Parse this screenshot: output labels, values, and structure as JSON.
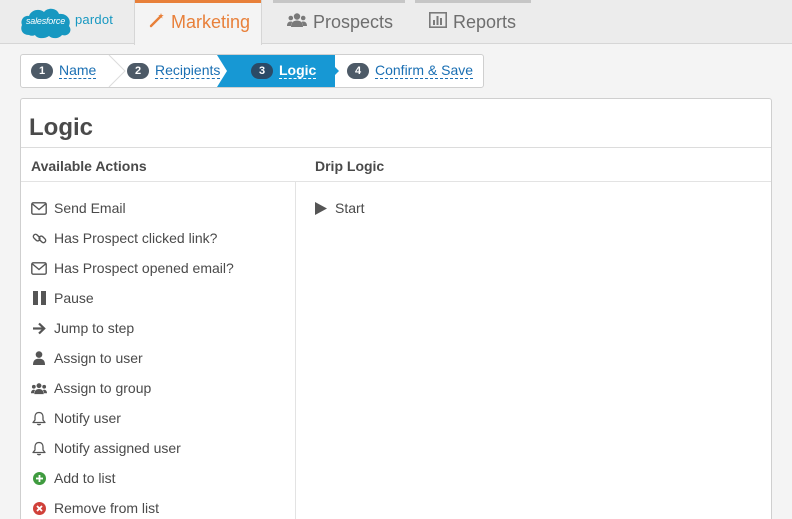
{
  "brand": {
    "cloud_text": "salesforce",
    "product_text": "pardot"
  },
  "nav": {
    "tabs": [
      {
        "label": "Marketing",
        "icon": "magic-wand-icon",
        "active": true
      },
      {
        "label": "Prospects",
        "icon": "users-icon",
        "active": false
      },
      {
        "label": "Reports",
        "icon": "bar-chart-icon",
        "active": false
      }
    ]
  },
  "wizard": {
    "steps": [
      {
        "num": "1",
        "label": "Name"
      },
      {
        "num": "2",
        "label": "Recipients"
      },
      {
        "num": "3",
        "label": "Logic",
        "current": true
      },
      {
        "num": "4",
        "label": "Confirm & Save"
      }
    ]
  },
  "panel": {
    "title": "Logic",
    "actions_header": "Available Actions",
    "drip_header": "Drip Logic",
    "actions": [
      {
        "label": "Send Email",
        "icon": "envelope-icon"
      },
      {
        "label": "Has Prospect clicked link?",
        "icon": "link-icon"
      },
      {
        "label": "Has Prospect opened email?",
        "icon": "envelope-icon"
      },
      {
        "label": "Pause",
        "icon": "pause-icon"
      },
      {
        "label": "Jump to step",
        "icon": "arrow-right-icon"
      },
      {
        "label": "Assign to user",
        "icon": "user-icon"
      },
      {
        "label": "Assign to group",
        "icon": "group-icon"
      },
      {
        "label": "Notify user",
        "icon": "bell-icon"
      },
      {
        "label": "Notify assigned user",
        "icon": "bell-icon"
      },
      {
        "label": "Add to list",
        "icon": "plus-circle-icon"
      },
      {
        "label": "Remove from list",
        "icon": "remove-circle-icon"
      }
    ],
    "drip": [
      {
        "label": "Start",
        "icon": "play-icon"
      }
    ]
  },
  "colors": {
    "accent_orange": "#e8803a",
    "step_active_blue": "#1798d4",
    "link_blue": "#1a6fb3",
    "add_green": "#3f9b3f",
    "remove_red": "#d0413a"
  }
}
